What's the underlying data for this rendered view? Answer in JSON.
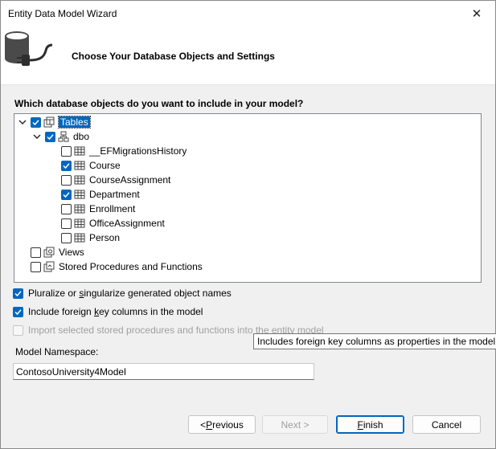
{
  "window": {
    "title": "Entity Data Model Wizard",
    "close_glyph": "✕"
  },
  "header": {
    "title": "Choose Your Database Objects and Settings",
    "icon": "database-plug-icon"
  },
  "question": "Which database objects do you want to include in your model?",
  "tree": {
    "tables": {
      "label": "Tables",
      "checked": true,
      "expanded": true
    },
    "dbo": {
      "label": "dbo",
      "checked": true,
      "expanded": true
    },
    "items": [
      {
        "label": "__EFMigrationsHistory",
        "checked": false
      },
      {
        "label": "Course",
        "checked": true
      },
      {
        "label": "CourseAssignment",
        "checked": false
      },
      {
        "label": "Department",
        "checked": true
      },
      {
        "label": "Enrollment",
        "checked": false
      },
      {
        "label": "OfficeAssignment",
        "checked": false
      },
      {
        "label": "Person",
        "checked": false
      }
    ],
    "views": {
      "label": "Views",
      "checked": false
    },
    "stored": {
      "label": "Stored Procedures and Functions",
      "checked": false
    }
  },
  "options": {
    "pluralize": {
      "pre": "Pluralize or ",
      "u": "s",
      "post": "ingularize generated object names",
      "checked": true
    },
    "foreign_keys": {
      "pre": "Include foreign ",
      "u": "k",
      "post": "ey columns in the model",
      "checked": true
    },
    "import_sprocs": {
      "label": "Import selected stored procedures and functions into the entity model",
      "checked": false,
      "disabled": true
    }
  },
  "tooltip": "Includes foreign key columns as properties in the model.",
  "namespace": {
    "label": "Model Namespace:",
    "value": "ContosoUniversity4Model"
  },
  "buttons": {
    "previous": {
      "pre": "< ",
      "u": "P",
      "post": "revious"
    },
    "next": "Next >",
    "finish": {
      "u": "F",
      "post": "inish"
    },
    "cancel": "Cancel"
  },
  "colors": {
    "accent": "#0067c0",
    "background": "#f0f0f0"
  }
}
